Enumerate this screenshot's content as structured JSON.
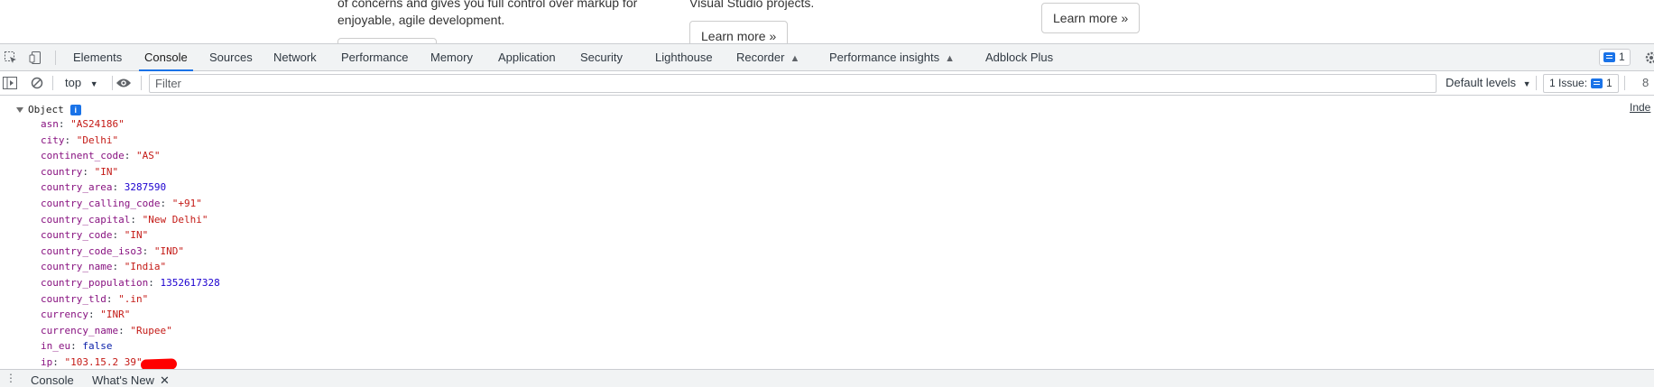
{
  "page": {
    "col1_line1": "of concerns and gives you full control over markup for",
    "col1_line2": "enjoyable, agile development.",
    "col2_line1": "Visual Studio projects.",
    "col2_button": "Learn more »",
    "col3_button": "Learn more »"
  },
  "devtools": {
    "tabs": [
      {
        "label": "Elements"
      },
      {
        "label": "Console"
      },
      {
        "label": "Sources"
      },
      {
        "label": "Network"
      },
      {
        "label": "Performance"
      },
      {
        "label": "Memory"
      },
      {
        "label": "Application"
      },
      {
        "label": "Security"
      },
      {
        "label": "Lighthouse"
      },
      {
        "label": "Recorder"
      },
      {
        "label": "Performance insights"
      },
      {
        "label": "Adblock Plus"
      }
    ],
    "active_tab": "Console",
    "message_count": "1",
    "icons": {
      "inspect": "inspect-element-icon",
      "device": "device-toolbar-icon",
      "flask": "experiment-flask-icon",
      "settings": "gear-icon"
    }
  },
  "console_toolbar": {
    "context": "top",
    "filter_placeholder": "Filter",
    "levels": "Default levels",
    "issues_label": "1 Issue:",
    "issues_count": "1",
    "hidden_count": "8"
  },
  "console": {
    "object_label": "Object",
    "info_badge": "i",
    "source_link": "Inde",
    "properties": [
      {
        "key": "asn",
        "value": "\"AS24186\"",
        "type": "string"
      },
      {
        "key": "city",
        "value": "\"Delhi\"",
        "type": "string"
      },
      {
        "key": "continent_code",
        "value": "\"AS\"",
        "type": "string"
      },
      {
        "key": "country",
        "value": "\"IN\"",
        "type": "string"
      },
      {
        "key": "country_area",
        "value": "3287590",
        "type": "number"
      },
      {
        "key": "country_calling_code",
        "value": "\"+91\"",
        "type": "string"
      },
      {
        "key": "country_capital",
        "value": "\"New Delhi\"",
        "type": "string"
      },
      {
        "key": "country_code",
        "value": "\"IN\"",
        "type": "string"
      },
      {
        "key": "country_code_iso3",
        "value": "\"IND\"",
        "type": "string"
      },
      {
        "key": "country_name",
        "value": "\"India\"",
        "type": "string"
      },
      {
        "key": "country_population",
        "value": "1352617328",
        "type": "number"
      },
      {
        "key": "country_tld",
        "value": "\".in\"",
        "type": "string"
      },
      {
        "key": "currency",
        "value": "\"INR\"",
        "type": "string"
      },
      {
        "key": "currency_name",
        "value": "\"Rupee\"",
        "type": "string"
      },
      {
        "key": "in_eu",
        "value": "false",
        "type": "boolean"
      },
      {
        "key": "ip",
        "value": "\"103.15.2     39\"",
        "type": "string"
      }
    ]
  },
  "drawer": {
    "tabs": [
      {
        "label": "Console"
      },
      {
        "label": "What's New",
        "closable": true
      }
    ]
  },
  "colors": {
    "accent": "#1a73e8",
    "prop_key": "#881280",
    "string_value": "#c41a16",
    "number_value": "#1c00cf",
    "redaction": "#ff0000"
  }
}
